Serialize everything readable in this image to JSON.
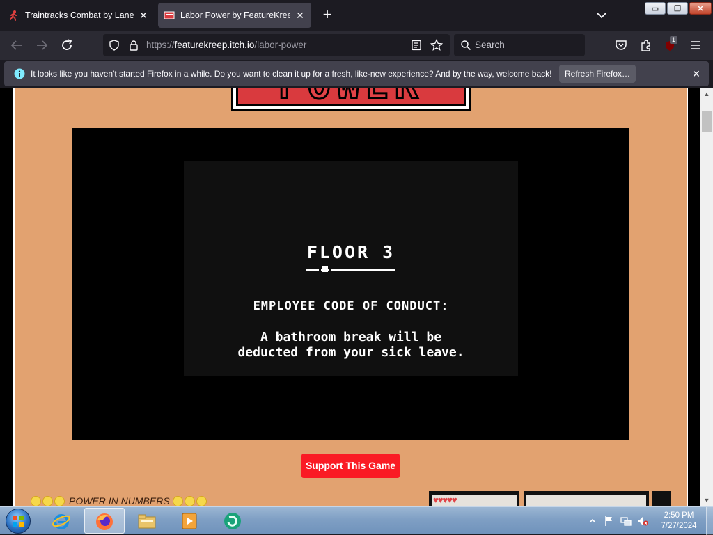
{
  "browser": {
    "tabs": [
      {
        "title": "Traintracks Combat by Lane D.",
        "close": "✕",
        "icon": "runner-icon"
      },
      {
        "title": "Labor Power by FeatureKreep",
        "close": "✕",
        "icon": "game-favicon",
        "active": true
      }
    ],
    "new_tab": "+",
    "window_controls": {
      "minimize": "▭",
      "maximize": "❐",
      "close": "✕"
    },
    "url": {
      "prefix": "https://",
      "domain": "featurekreep.itch.io",
      "path": "/labor-power"
    },
    "search_placeholder": "Search",
    "extension_badge": "1"
  },
  "notification": {
    "message": "It looks like you haven't started Firefox in a while. Do you want to clean it up for a fresh, like-new experience? And by the way, welcome back!",
    "button": "Refresh Firefox…",
    "close": "✕"
  },
  "page": {
    "logo_text": "POWER",
    "game": {
      "floor": "FLOOR 3",
      "heading": "EMPLOYEE CODE OF CONDUCT:",
      "line1": "A bathroom break will be",
      "line2": "deducted from your sick leave."
    },
    "support_button": "Support This Game",
    "section_title": "POWER IN NUMBERS",
    "hearts": "♥♥♥♥♥",
    "colors": {
      "page_bg": "#e2a270",
      "support": "#fa1b24",
      "logo_red": "#e14347"
    }
  },
  "taskbar": {
    "time": "2:50 PM",
    "date": "7/27/2024",
    "apps": [
      "internet-explorer-icon",
      "firefox-icon",
      "file-explorer-icon",
      "media-player-icon",
      "green-app-icon"
    ]
  }
}
